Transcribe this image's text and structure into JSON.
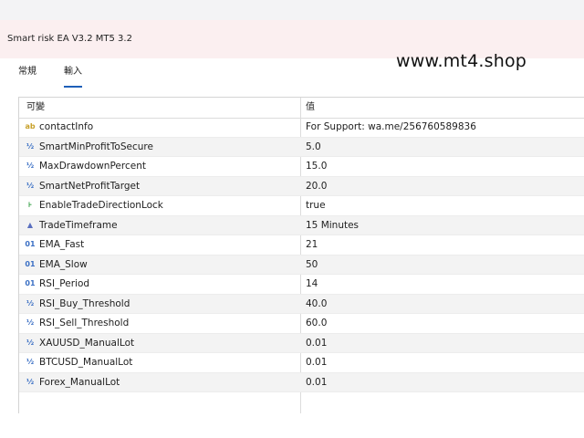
{
  "window": {
    "title": "Smart risk EA V3.2 MT5 3.2"
  },
  "watermark": "www.mt4.shop",
  "tabs": [
    {
      "label": "常規"
    },
    {
      "label": "輸入"
    }
  ],
  "table": {
    "headers": {
      "variable": "可變",
      "value": "值"
    },
    "rows": [
      {
        "icon": "ab",
        "name": "contactInfo",
        "value": "For Support: wa.me/256760589836"
      },
      {
        "icon": "½",
        "name": "SmartMinProfitToSecure",
        "value": "5.0"
      },
      {
        "icon": "½",
        "name": "MaxDrawdownPercent",
        "value": "15.0"
      },
      {
        "icon": "½",
        "name": "SmartNetProfitTarget",
        "value": "20.0"
      },
      {
        "icon": "⊦",
        "name": "EnableTradeDirectionLock",
        "value": "true"
      },
      {
        "icon": "▲",
        "name": "TradeTimeframe",
        "value": "15 Minutes"
      },
      {
        "icon": "01",
        "name": "EMA_Fast",
        "value": "21"
      },
      {
        "icon": "01",
        "name": "EMA_Slow",
        "value": "50"
      },
      {
        "icon": "01",
        "name": "RSI_Period",
        "value": "14"
      },
      {
        "icon": "½",
        "name": "RSI_Buy_Threshold",
        "value": "40.0"
      },
      {
        "icon": "½",
        "name": "RSI_Sell_Threshold",
        "value": "60.0"
      },
      {
        "icon": "½",
        "name": "XAUUSD_ManualLot",
        "value": "0.01"
      },
      {
        "icon": "½",
        "name": "BTCUSD_ManualLot",
        "value": "0.01"
      },
      {
        "icon": "½",
        "name": "Forex_ManualLot",
        "value": "0.01"
      }
    ]
  }
}
